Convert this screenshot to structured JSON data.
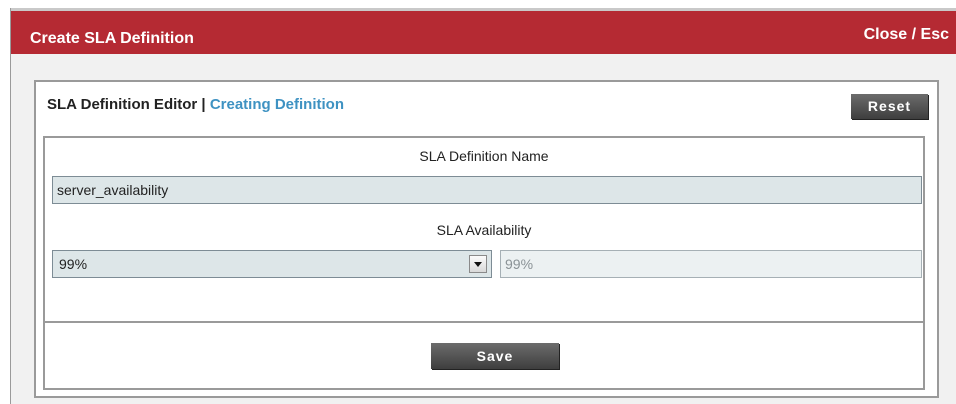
{
  "dialog": {
    "title": "Create SLA Definition",
    "close_label": "Close / Esc"
  },
  "editor": {
    "title": "SLA Definition Editor",
    "separator": " | ",
    "state": "Creating Definition",
    "reset_label": "Reset"
  },
  "form": {
    "name_label": "SLA Definition Name",
    "name_value": "server_availability",
    "availability_label": "SLA Availability",
    "availability_selected": "99%",
    "availability_value": "99%",
    "save_label": "Save"
  },
  "colors": {
    "title_bar": "#b52a33",
    "state_text": "#3e92c2",
    "button": "#4a4a4a",
    "input_bg": "#dde6e8"
  },
  "icons": {
    "dropdown": "chevron-down-icon"
  }
}
